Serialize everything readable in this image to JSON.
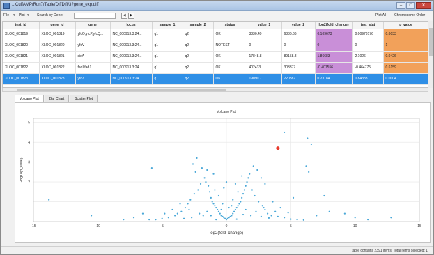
{
  "window": {
    "title": "...CuffAMP/Run7/Table/DiffDiff/3?gene_exp.diff",
    "controls": {
      "minimize": "–",
      "maximize": "□",
      "close": "✕"
    }
  },
  "toolbar": {
    "file_label": "File",
    "plot_label": "Plot",
    "search_label": "Search by Gene:",
    "search_value": "",
    "prev_icon": "◀",
    "next_icon": "▶",
    "plot_all_label": "Plot All",
    "chrom_order_label": "Chromosome Order"
  },
  "table": {
    "columns": [
      "test_id",
      "gene_id",
      "gene",
      "locus",
      "sample_1",
      "sample_2",
      "status",
      "value_1",
      "value_2",
      "log2(fold_change)",
      "test_stat",
      "p_value"
    ],
    "rows": [
      [
        "XLOC_001819",
        "XLOC_001819",
        "yfcO,yfcP,yfcQ...",
        "NC_000913.3:24...",
        "q1",
        "q2",
        "OK",
        "3830.49",
        "6836.66",
        "0.109673",
        "0.00978176",
        "0.6033"
      ],
      [
        "XLOC_001820",
        "XLOC_001820",
        "yfcV",
        "NC_000913.3:24...",
        "q1",
        "q2",
        "NOTEST",
        "0",
        "0",
        "0",
        "0",
        "1"
      ],
      [
        "XLOC_001821",
        "XLOC_001821",
        "sixA",
        "NC_000913.3:24...",
        "q1",
        "q2",
        "OK",
        "17848.8",
        "89158.8",
        "1.86683",
        "2.1026",
        "0.0426"
      ],
      [
        "XLOC_001822",
        "XLOC_001822",
        "fadI,fadJ",
        "NC_000913.3:24...",
        "q1",
        "q2",
        "OK",
        "402433",
        "303377",
        "-0.407556",
        "-0.464775",
        "0.6159"
      ],
      [
        "XLOC_001823",
        "XLOC_001823",
        "yfcZ",
        "NC_000913.3:24...",
        "q1",
        "q2",
        "OK",
        "19090.7",
        "220887",
        "0.23184",
        "0.84383",
        "0.0004"
      ]
    ],
    "selected_row": 4,
    "fc_color": "#c98fd8",
    "p_color": "#f2a15a",
    "selected_color": "#2f8fe6"
  },
  "tabs": [
    "Volcano Plot",
    "Bar Chart",
    "Scatter Plot"
  ],
  "status_bar": "table contains 2391 items.  Total items selected: 1",
  "chart_data": {
    "type": "scatter",
    "title": "Volcano Plot",
    "xlabel": "log2(fold_change)",
    "ylabel": "-log10(p_value)",
    "xlim": [
      -15,
      15
    ],
    "ylim": [
      0,
      5.2
    ],
    "x_ticks": [
      -15,
      -10,
      -5,
      0,
      5,
      10,
      15
    ],
    "y_ticks": [
      1,
      2,
      3,
      4,
      5
    ],
    "grid": true,
    "point_color": "#4aa8d8",
    "highlight_color": "#e83b2e",
    "highlight": {
      "x": 4.0,
      "y": 3.7
    },
    "points": [
      [
        -1.7,
        2.2
      ],
      [
        -1.6,
        2.0
      ],
      [
        -1.4,
        1.8
      ],
      [
        -1.3,
        1.5
      ],
      [
        -1.2,
        1.2
      ],
      [
        -1.1,
        1.0
      ],
      [
        -1.0,
        0.9
      ],
      [
        -0.9,
        0.8
      ],
      [
        -0.8,
        0.7
      ],
      [
        -0.7,
        0.6
      ],
      [
        -0.6,
        0.5
      ],
      [
        -0.5,
        0.4
      ],
      [
        -0.4,
        0.3
      ],
      [
        -0.3,
        0.25
      ],
      [
        -0.2,
        0.2
      ],
      [
        -0.1,
        0.15
      ],
      [
        0.0,
        0.1
      ],
      [
        0.1,
        0.15
      ],
      [
        0.2,
        0.2
      ],
      [
        0.3,
        0.25
      ],
      [
        0.4,
        0.3
      ],
      [
        0.5,
        0.4
      ],
      [
        0.6,
        0.5
      ],
      [
        0.7,
        0.6
      ],
      [
        0.8,
        0.7
      ],
      [
        0.9,
        0.8
      ],
      [
        1.0,
        0.9
      ],
      [
        1.1,
        1.0
      ],
      [
        1.2,
        1.2
      ],
      [
        1.3,
        1.4
      ],
      [
        1.4,
        1.6
      ],
      [
        1.5,
        1.8
      ],
      [
        1.6,
        2.0
      ],
      [
        1.7,
        2.2
      ],
      [
        1.8,
        2.4
      ],
      [
        -2.2,
        1.6
      ],
      [
        -2.0,
        1.9
      ],
      [
        -2.5,
        1.4
      ],
      [
        -2.8,
        1.1
      ],
      [
        -3.0,
        0.9
      ],
      [
        -3.2,
        0.7
      ],
      [
        -3.5,
        0.5
      ],
      [
        -2.4,
        2.5
      ],
      [
        -1.9,
        2.7
      ],
      [
        -1.5,
        2.6
      ],
      [
        -2.6,
        2.9
      ],
      [
        -4.0,
        0.3
      ],
      [
        -4.5,
        0.2
      ],
      [
        -5.0,
        0.15
      ],
      [
        -5.5,
        0.1
      ],
      [
        -6.0,
        0.1
      ],
      [
        -3.8,
        0.4
      ],
      [
        -4.2,
        0.6
      ],
      [
        -2.1,
        0.4
      ],
      [
        -1.8,
        0.3
      ],
      [
        2.0,
        1.6
      ],
      [
        2.2,
        1.3
      ],
      [
        2.5,
        1.0
      ],
      [
        2.8,
        0.8
      ],
      [
        3.0,
        0.6
      ],
      [
        3.2,
        0.4
      ],
      [
        3.5,
        0.3
      ],
      [
        2.4,
        2.6
      ],
      [
        2.7,
        2.2
      ],
      [
        3.0,
        1.9
      ],
      [
        2.1,
        2.8
      ],
      [
        4.0,
        0.25
      ],
      [
        4.5,
        0.2
      ],
      [
        5.0,
        0.12
      ],
      [
        5.5,
        0.1
      ],
      [
        6.0,
        0.08
      ],
      [
        3.8,
        0.5
      ],
      [
        4.2,
        0.7
      ],
      [
        2.3,
        0.5
      ],
      [
        1.9,
        0.3
      ],
      [
        -0.6,
        1.3
      ],
      [
        -0.3,
        0.9
      ],
      [
        0.2,
        0.7
      ],
      [
        0.5,
        1.1
      ],
      [
        -0.9,
        1.6
      ],
      [
        0.9,
        1.5
      ],
      [
        -0.4,
        0.6
      ],
      [
        0.4,
        0.8
      ],
      [
        -1.5,
        0.5
      ],
      [
        1.5,
        0.6
      ],
      [
        -2.7,
        0.2
      ],
      [
        2.7,
        0.25
      ],
      [
        -3.3,
        0.15
      ],
      [
        3.3,
        0.18
      ],
      [
        -7.2,
        0.2
      ],
      [
        -8.0,
        0.1
      ],
      [
        7.0,
        0.3
      ],
      [
        8.0,
        0.5
      ],
      [
        9.2,
        0.4
      ],
      [
        10.0,
        0.2
      ],
      [
        11.0,
        0.1
      ],
      [
        12.8,
        0.2
      ],
      [
        -10.5,
        0.3
      ],
      [
        -13.8,
        1.1
      ],
      [
        -5.8,
        2.7
      ],
      [
        -2.3,
        3.2
      ],
      [
        6.2,
        2.8
      ],
      [
        6.4,
        2.5
      ],
      [
        6.3,
        4.2
      ],
      [
        6.6,
        3.9
      ],
      [
        4.5,
        4.5
      ],
      [
        5.2,
        1.2
      ],
      [
        7.6,
        1.3
      ],
      [
        -6.5,
        0.4
      ],
      [
        -1.0,
        2.4
      ],
      [
        1.2,
        2.3
      ],
      [
        0.0,
        2.0
      ],
      [
        -0.2,
        1.7
      ],
      [
        0.7,
        1.9
      ],
      [
        -1.2,
        0.3
      ],
      [
        1.3,
        0.35
      ],
      [
        -0.8,
        0.1
      ],
      [
        0.8,
        0.12
      ],
      [
        -2.9,
        0.6
      ],
      [
        2.9,
        0.7
      ],
      [
        -3.6,
        0.9
      ],
      [
        3.6,
        1.0
      ],
      [
        -4.8,
        0.4
      ],
      [
        4.8,
        0.45
      ]
    ]
  }
}
